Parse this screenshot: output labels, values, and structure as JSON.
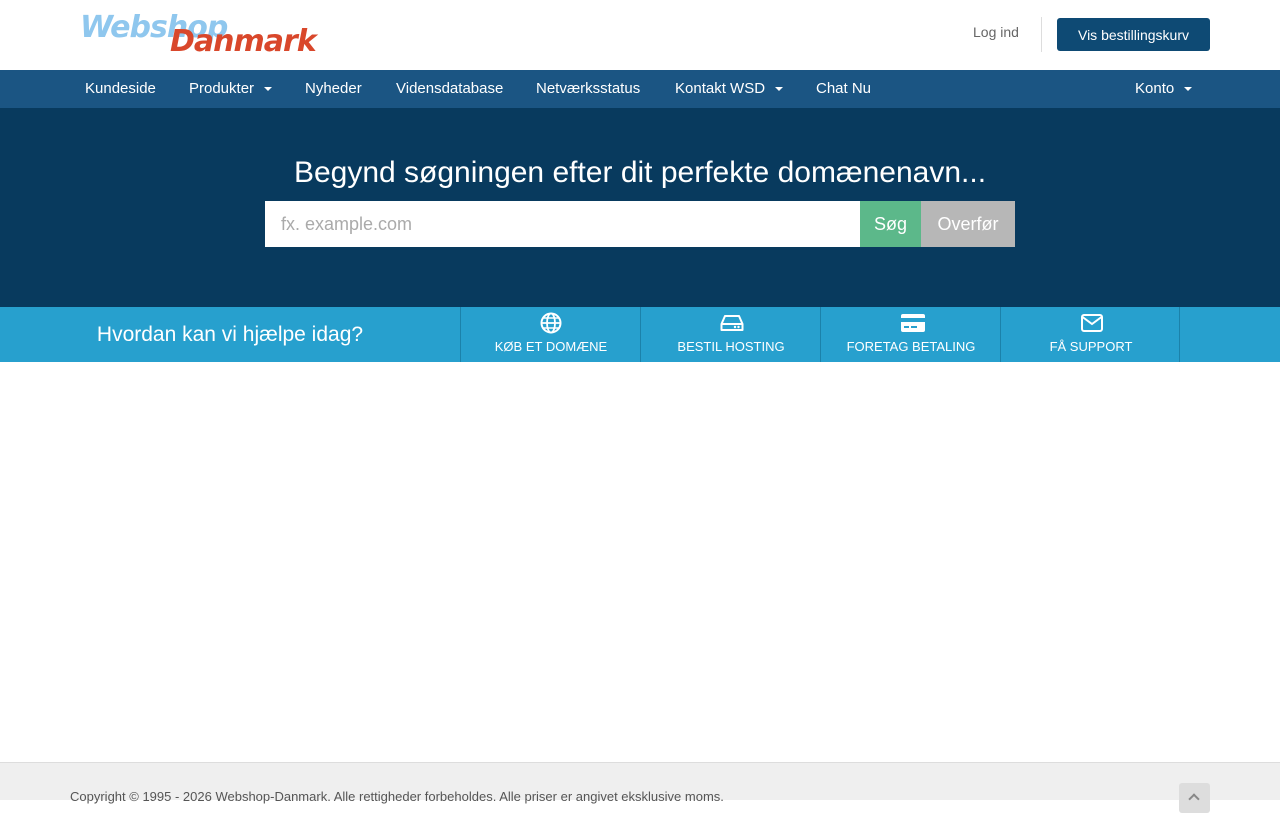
{
  "header": {
    "logo_text_top": "Webshop",
    "logo_text_bottom": "Danmark",
    "login_label": "Log ind",
    "cart_button": "Vis bestillingskurv"
  },
  "nav": {
    "items": [
      {
        "label": "Kundeside"
      },
      {
        "label": "Produkter"
      },
      {
        "label": "Nyheder"
      },
      {
        "label": "Vidensdatabase"
      },
      {
        "label": "Netværksstatus"
      },
      {
        "label": "Kontakt WSD"
      },
      {
        "label": "Chat Nu"
      }
    ],
    "account_label": "Konto"
  },
  "hero": {
    "title": "Begynd søgningen efter dit perfekte domænenavn...",
    "search_placeholder": "fx. example.com",
    "search_button": "Søg",
    "transfer_button": "Overfør"
  },
  "help": {
    "title": "Hvordan kan vi hjælpe idag?",
    "items": [
      {
        "label": "Køb et domæne",
        "icon": "globe-icon"
      },
      {
        "label": "Bestil hosting",
        "icon": "hdd-icon"
      },
      {
        "label": "Foretag betaling",
        "icon": "credit-card-icon"
      },
      {
        "label": "Få support",
        "icon": "envelope-icon"
      }
    ]
  },
  "footer": {
    "copyright": "Copyright © 1995 - 2026 Webshop-Danmark. Alle rettigheder forbeholdes. Alle priser er angivet eksklusive moms."
  },
  "colors": {
    "navbar": "#1b5583",
    "hero": "#083a5e",
    "help_strip": "#27a0ce",
    "cart_button": "#0e4a74",
    "search_button": "#5cb88a",
    "transfer_button": "#b7b7b7"
  }
}
